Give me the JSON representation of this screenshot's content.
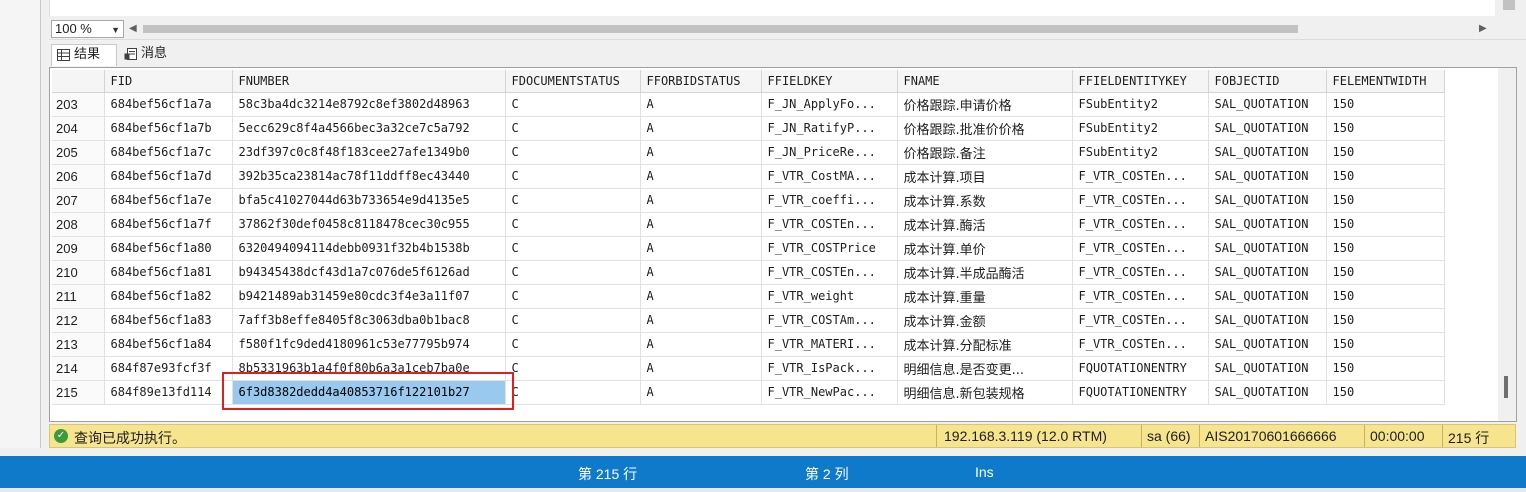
{
  "zoom": {
    "value": "100 %"
  },
  "tabs": [
    {
      "label": "结果",
      "icon": "grid-icon"
    },
    {
      "label": "消息",
      "icon": "messages-icon"
    }
  ],
  "grid": {
    "columns": [
      "",
      "FID",
      "FNUMBER",
      "FDOCUMENTSTATUS",
      "FFORBIDSTATUS",
      "FFIELDKEY",
      "FNAME",
      "FFIELDENTITYKEY",
      "FOBJECTID",
      "FELEMENTWIDTH"
    ],
    "rows": [
      [
        "203",
        "684bef56cf1a7a",
        "58c3ba4dc3214e8792c8ef3802d48963",
        "C",
        "A",
        "F_JN_ApplyFo...",
        "价格跟踪.申请价格",
        "FSubEntity2",
        "SAL_QUOTATION",
        "150"
      ],
      [
        "204",
        "684bef56cf1a7b",
        "5ecc629c8f4a4566bec3a32ce7c5a792",
        "C",
        "A",
        "F_JN_RatifyP...",
        "价格跟踪.批准价价格",
        "FSubEntity2",
        "SAL_QUOTATION",
        "150"
      ],
      [
        "205",
        "684bef56cf1a7c",
        "23df397c0c8f48f183cee27afe1349b0",
        "C",
        "A",
        "F_JN_PriceRe...",
        "价格跟踪.备注",
        "FSubEntity2",
        "SAL_QUOTATION",
        "150"
      ],
      [
        "206",
        "684bef56cf1a7d",
        "392b35ca23814ac78f11ddff8ec43440",
        "C",
        "A",
        "F_VTR_CostMA...",
        "成本计算.项目",
        "F_VTR_COSTEn...",
        "SAL_QUOTATION",
        "150"
      ],
      [
        "207",
        "684bef56cf1a7e",
        "bfa5c41027044d63b733654e9d4135e5",
        "C",
        "A",
        "F_VTR_coeffi...",
        "成本计算.系数",
        "F_VTR_COSTEn...",
        "SAL_QUOTATION",
        "150"
      ],
      [
        "208",
        "684bef56cf1a7f",
        "37862f30def0458c8118478cec30c955",
        "C",
        "A",
        "F_VTR_COSTEn...",
        "成本计算.酶活",
        "F_VTR_COSTEn...",
        "SAL_QUOTATION",
        "150"
      ],
      [
        "209",
        "684bef56cf1a80",
        "6320494094114debb0931f32b4b1538b",
        "C",
        "A",
        "F_VTR_COSTPrice",
        "成本计算.单价",
        "F_VTR_COSTEn...",
        "SAL_QUOTATION",
        "150"
      ],
      [
        "210",
        "684bef56cf1a81",
        "b94345438dcf43d1a7c076de5f6126ad",
        "C",
        "A",
        "F_VTR_COSTEn...",
        "成本计算.半成品酶活",
        "F_VTR_COSTEn...",
        "SAL_QUOTATION",
        "150"
      ],
      [
        "211",
        "684bef56cf1a82",
        "b9421489ab31459e80cdc3f4e3a11f07",
        "C",
        "A",
        "F_VTR_weight",
        "成本计算.重量",
        "F_VTR_COSTEn...",
        "SAL_QUOTATION",
        "150"
      ],
      [
        "212",
        "684bef56cf1a83",
        "7aff3b8effe8405f8c3063dba0b1bac8",
        "C",
        "A",
        "F_VTR_COSTAm...",
        "成本计算.金额",
        "F_VTR_COSTEn...",
        "SAL_QUOTATION",
        "150"
      ],
      [
        "213",
        "684bef56cf1a84",
        "f580f1fc9ded4180961c53e77795b974",
        "C",
        "A",
        "F_VTR_MATERI...",
        "成本计算.分配标准",
        "F_VTR_COSTEn...",
        "SAL_QUOTATION",
        "150"
      ],
      [
        "214",
        "684f87e93fcf3f",
        "8b5331963b1a4f0f80b6a3a1ceb7ba0e",
        "C",
        "A",
        "F_VTR_IsPack...",
        "明细信息.是否变更...",
        "FQUOTATIONENTRY",
        "SAL_QUOTATION",
        "150"
      ],
      [
        "215",
        "684f89e13fd114",
        "6f3d8382dedd4a40853716f122101b27",
        "C",
        "A",
        "F_VTR_NewPac...",
        "明细信息.新包装规格",
        "FQUOTATIONENTRY",
        "SAL_QUOTATION",
        "150"
      ]
    ],
    "selected": {
      "row": 12,
      "col": 2
    }
  },
  "status": {
    "icon": "success-check-icon",
    "message": "查询已成功执行。",
    "server": "192.168.3.119 (12.0 RTM)",
    "user": "sa (66)",
    "database": "AIS20170601666666",
    "elapsed": "00:00:00",
    "rows": "215 行"
  },
  "ide_status": {
    "line": "第 215 行",
    "column": "第 2 列",
    "mode": "Ins"
  },
  "colors": {
    "status_bg": "#f6e48e",
    "ide_status_bg": "#0f7ac9",
    "selection_bg": "#99c9ef",
    "highlight_outline": "#e0201d"
  }
}
